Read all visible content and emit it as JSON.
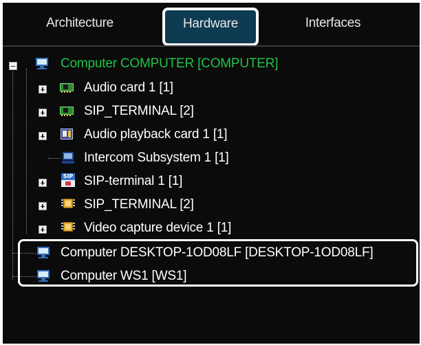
{
  "tabs": [
    {
      "label": "Architecture",
      "active": false
    },
    {
      "label": "Hardware",
      "active": true
    },
    {
      "label": "Interfaces",
      "active": false
    }
  ],
  "tree": {
    "root": {
      "label": "Computer COMPUTER [COMPUTER]",
      "icon": "monitor-icon",
      "expanded": true,
      "color": "#22c24a"
    },
    "children": [
      {
        "label": "Audio card 1 [1]",
        "icon": "audio-card-icon",
        "expandable": true
      },
      {
        "label": "SIP_TERMINAL [2]",
        "icon": "audio-card-icon",
        "expandable": true
      },
      {
        "label": "Audio playback card 1 [1]",
        "icon": "audio-playback-card-icon",
        "expandable": true
      },
      {
        "label": "Intercom Subsystem 1 [1]",
        "icon": "intercom-icon",
        "expandable": false
      },
      {
        "label": "SIP-terminal 1 [1]",
        "icon": "sip-terminal-icon",
        "expandable": true
      },
      {
        "label": "SIP_TERMINAL [2]",
        "icon": "chip-icon",
        "expandable": true
      },
      {
        "label": "Video capture device 1 [1]",
        "icon": "chip-icon",
        "expandable": true
      }
    ],
    "siblings": [
      {
        "label": "Computer DESKTOP-1OD08LF [DESKTOP-1OD08LF]",
        "icon": "monitor-icon"
      },
      {
        "label": "Computer WS1 [WS1]",
        "icon": "monitor-icon"
      }
    ]
  },
  "colors": {
    "panel_bg": "#0b0b0b",
    "active_tab_bg": "#0e3a52",
    "root_text": "#22c24a",
    "text": "#ffffff"
  }
}
